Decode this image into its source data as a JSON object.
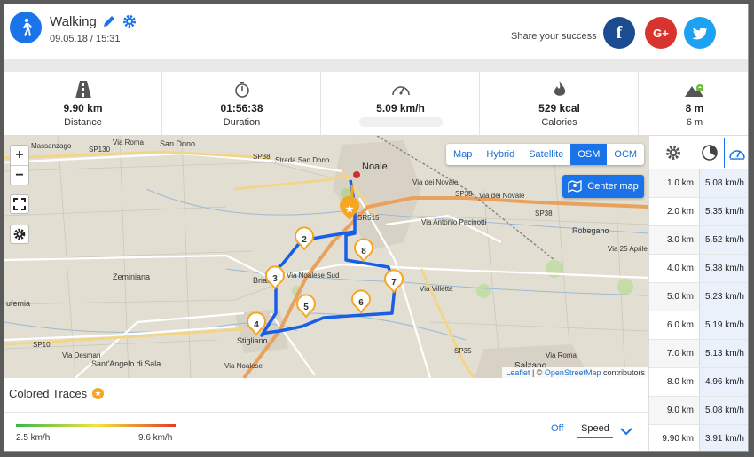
{
  "activity": {
    "type": "Walking",
    "datetime": "09.05.18 / 15:31"
  },
  "share": {
    "label": "Share your success",
    "facebook": "f",
    "googleplus": "G+",
    "twitter": "t"
  },
  "stats": [
    {
      "icon": "road-icon",
      "value": "9.90 km",
      "label": "Distance"
    },
    {
      "icon": "stopwatch-icon",
      "value": "01:56:38",
      "label": "Duration"
    },
    {
      "icon": "speedometer-icon",
      "value": "5.09 km/h",
      "label": ""
    },
    {
      "icon": "flame-icon",
      "value": "529 kcal",
      "label": "Calories"
    },
    {
      "icon": "mountain-icon",
      "value": "8 m",
      "label": "6 m"
    }
  ],
  "map": {
    "zoom_in": "+",
    "zoom_out": "−",
    "layers": [
      "Map",
      "Hybrid",
      "Satellite",
      "OSM",
      "OCM"
    ],
    "active_layer": "OSM",
    "center_button": "Center map",
    "attribution": {
      "leaflet": "Leaflet",
      "sep": " | © ",
      "osm": "OpenStreetMap",
      "contrib": " contributors"
    },
    "places": [
      "Massanzago",
      "SP130",
      "Via Roma",
      "San Dono",
      "SP38",
      "Strada San Dono",
      "Noale",
      "Via dei Novale",
      "SP38",
      "Via dei Novale",
      "SR515",
      "Via Antonio Pacinotti",
      "SP38",
      "Robegano",
      "Via 25 Aprile",
      "Zeminiana",
      "Briana",
      "Via Noalese Sud",
      "Via Villetta",
      "ufemia",
      "SP10",
      "Via Desman",
      "Stigliano",
      "Sant'Angelo di Sala",
      "Via Noalese",
      "SP35",
      "Salzano",
      "Via Roma"
    ],
    "markers": [
      "2",
      "3",
      "4",
      "5",
      "6",
      "7",
      "8"
    ],
    "accent": "#1a73e8",
    "marker_color": "#f5a623"
  },
  "traces": {
    "title": "Colored Traces",
    "min": "2.5 km/h",
    "max": "9.6 km/h",
    "off": "Off",
    "selected": "Speed"
  },
  "splits": [
    {
      "km": "1.0 km",
      "speed": "5.08 km/h"
    },
    {
      "km": "2.0 km",
      "speed": "5.35 km/h"
    },
    {
      "km": "3.0 km",
      "speed": "5.52 km/h"
    },
    {
      "km": "4.0 km",
      "speed": "5.38 km/h"
    },
    {
      "km": "5.0 km",
      "speed": "5.23 km/h"
    },
    {
      "km": "6.0 km",
      "speed": "5.19 km/h"
    },
    {
      "km": "7.0 km",
      "speed": "5.13 km/h"
    },
    {
      "km": "8.0 km",
      "speed": "4.96 km/h"
    },
    {
      "km": "9.0 km",
      "speed": "5.08 km/h"
    },
    {
      "km": "9.90 km",
      "speed": "3.91 km/h"
    }
  ]
}
